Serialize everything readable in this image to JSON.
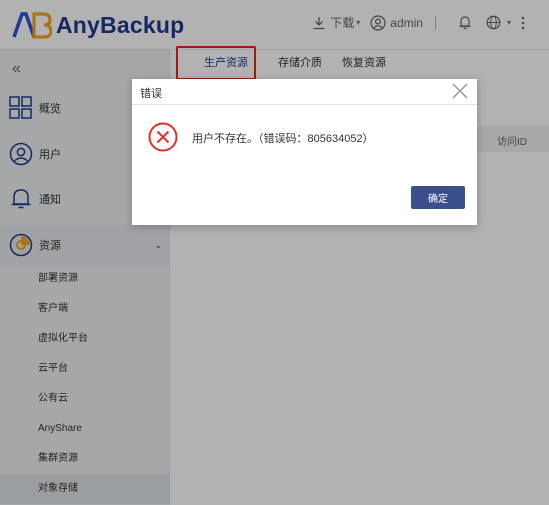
{
  "app": {
    "name": "AnyBackup"
  },
  "header": {
    "download_label": "下载",
    "user_label": "admin"
  },
  "sidebar": {
    "collapse_glyph": "«",
    "items": [
      {
        "label": "概览",
        "icon": "overview-grid-icon"
      },
      {
        "label": "用户",
        "icon": "user-icon"
      },
      {
        "label": "通知",
        "icon": "bell-icon"
      },
      {
        "label": "资源",
        "icon": "resource-icon"
      }
    ],
    "sub_items": [
      {
        "label": "部署资源"
      },
      {
        "label": "客户端"
      },
      {
        "label": "虚拟化平台"
      },
      {
        "label": "云平台"
      },
      {
        "label": "公有云"
      },
      {
        "label": "AnyShare"
      },
      {
        "label": "集群资源"
      },
      {
        "label": "对象存储"
      }
    ]
  },
  "main": {
    "tabs": [
      {
        "label": "生产资源"
      },
      {
        "label": "存储介质"
      },
      {
        "label": "恢复资源"
      }
    ],
    "table_column_right": "访问ID"
  },
  "dialog": {
    "title": "错误",
    "message": "用户不存在。（错误码：805634052）",
    "confirm_label": "确定"
  },
  "colors": {
    "brand": "#1f3a8f",
    "highlight": "#e4261e",
    "button": "#3b4f8c",
    "error": "#d9332b"
  }
}
